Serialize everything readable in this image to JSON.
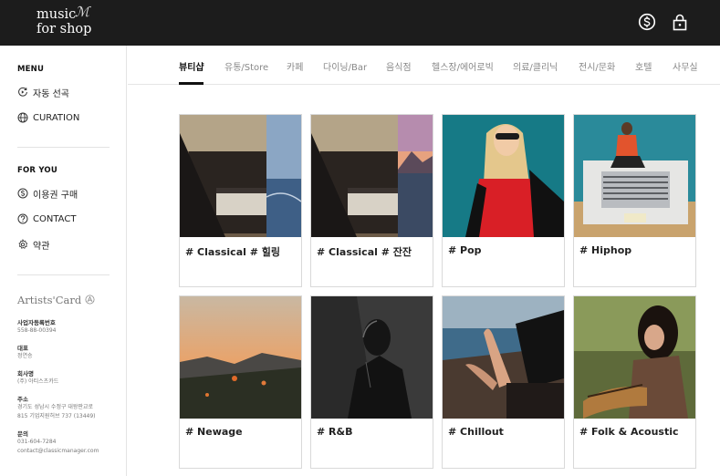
{
  "header": {
    "logo_line1": "music",
    "logo_line2": "for shop",
    "logo_mark": "ℳ",
    "icons": [
      "dollar-coin-icon",
      "lock-icon"
    ]
  },
  "sidebar": {
    "menu_title": "MENU",
    "menu_items": [
      {
        "label": "자동 선곡",
        "icon": "auto-play-icon"
      },
      {
        "label": "CURATION",
        "icon": "globe-icon"
      }
    ],
    "foryou_title": "FOR YOU",
    "foryou_items": [
      {
        "label": "이용권 구매",
        "icon": "dollar-coin-icon"
      },
      {
        "label": "CONTACT",
        "icon": "question-icon"
      },
      {
        "label": "약관",
        "icon": "settings-icon"
      }
    ],
    "artists_logo": "Artists'Card",
    "company": {
      "reg_label": "사업자등록번호",
      "reg_value": "558-88-00394",
      "ceo_label": "대표",
      "ceo_value": "정연승",
      "name_label": "회사명",
      "name_value": "(주) 아티스츠카드",
      "addr_label": "주소",
      "addr_line1": "경기도 성남시 수정구 대왕판교로",
      "addr_line2": "815 기업지원허브 737 (13449)",
      "contact_label": "문의",
      "phone": "031-604-7284",
      "email": "contact@classicmanager.com"
    }
  },
  "nav": {
    "tabs": [
      "뷰티샵",
      "유통/Store",
      "카페",
      "다이닝/Bar",
      "음식점",
      "헬스장/에어로빅",
      "의료/클리닉",
      "전시/문화",
      "호텔",
      "사무실"
    ],
    "active": "뷰티샵"
  },
  "cards": [
    {
      "tag": "# Classical # 힐링"
    },
    {
      "tag": "# Classical # 잔잔"
    },
    {
      "tag": "# Pop"
    },
    {
      "tag": "# Hiphop"
    },
    {
      "tag": "# Newage"
    },
    {
      "tag": "# R&B"
    },
    {
      "tag": "# Chillout"
    },
    {
      "tag": "# Folk & Acoustic"
    }
  ],
  "colors": {
    "topbar": "#1c1c1c",
    "active_tab": "#111111",
    "inactive_tab": "#888888"
  }
}
